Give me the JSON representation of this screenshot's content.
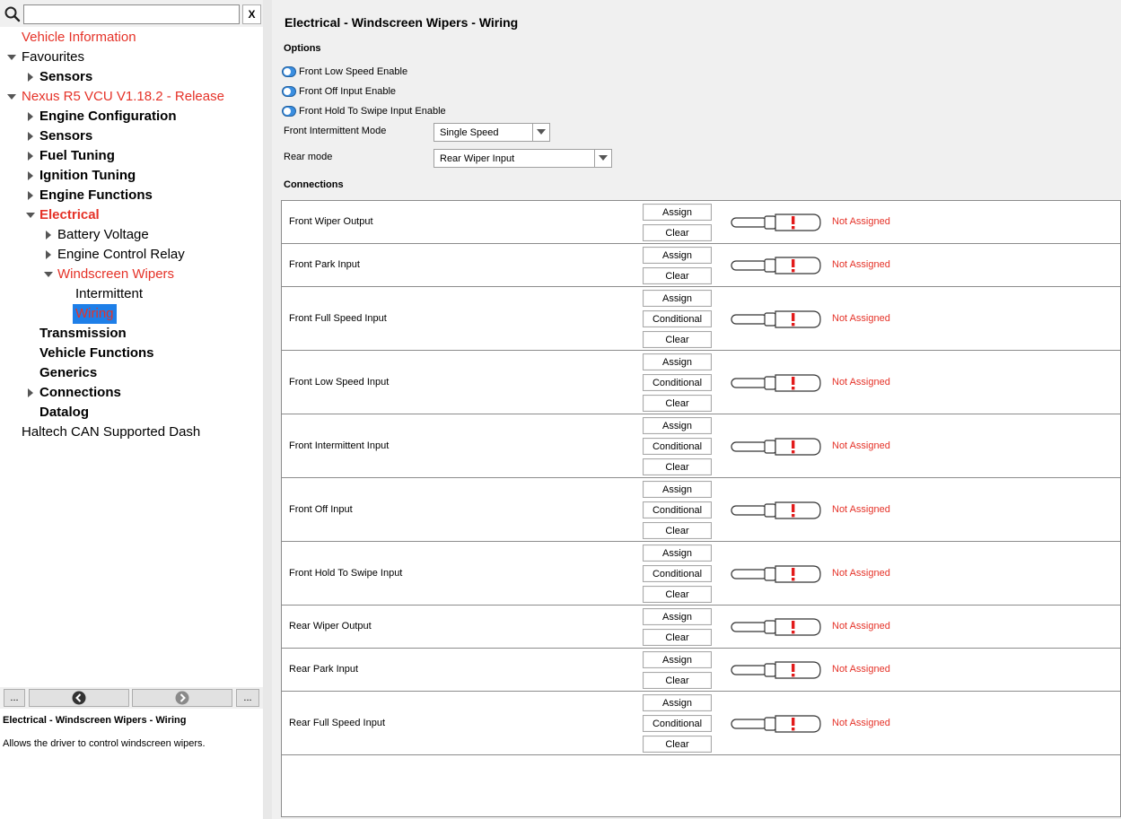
{
  "search": {
    "value": "",
    "clear_label": "X"
  },
  "tree": [
    {
      "label": "Vehicle Information",
      "level": 0,
      "arrow": "none",
      "style": "red"
    },
    {
      "label": "Favourites",
      "level": 0,
      "arrow": "down",
      "style": "normal"
    },
    {
      "label": "Sensors",
      "level": 1,
      "arrow": "right",
      "style": "bold"
    },
    {
      "label": "Nexus R5 VCU V1.18.2 - Release",
      "level": 0,
      "arrow": "down",
      "style": "red"
    },
    {
      "label": "Engine Configuration",
      "level": 1,
      "arrow": "right",
      "style": "bold"
    },
    {
      "label": "Sensors",
      "level": 1,
      "arrow": "right",
      "style": "bold"
    },
    {
      "label": "Fuel Tuning",
      "level": 1,
      "arrow": "right",
      "style": "bold"
    },
    {
      "label": "Ignition Tuning",
      "level": 1,
      "arrow": "right",
      "style": "bold"
    },
    {
      "label": "Engine Functions",
      "level": 1,
      "arrow": "right",
      "style": "bold"
    },
    {
      "label": "Electrical",
      "level": 1,
      "arrow": "down",
      "style": "red-bold"
    },
    {
      "label": "Battery Voltage",
      "level": 2,
      "arrow": "right",
      "style": "normal"
    },
    {
      "label": "Engine Control Relay",
      "level": 2,
      "arrow": "right",
      "style": "normal"
    },
    {
      "label": "Windscreen Wipers",
      "level": 2,
      "arrow": "down",
      "style": "red"
    },
    {
      "label": "Intermittent",
      "level": 3,
      "arrow": "none",
      "style": "normal"
    },
    {
      "label": "Wiring",
      "level": 3,
      "arrow": "none",
      "style": "selected"
    },
    {
      "label": "Transmission",
      "level": 1,
      "arrow": "none",
      "style": "bold"
    },
    {
      "label": "Vehicle Functions",
      "level": 1,
      "arrow": "none",
      "style": "bold"
    },
    {
      "label": "Generics",
      "level": 1,
      "arrow": "none",
      "style": "bold"
    },
    {
      "label": "Connections",
      "level": 1,
      "arrow": "right",
      "style": "bold"
    },
    {
      "label": "Datalog",
      "level": 1,
      "arrow": "none",
      "style": "bold"
    },
    {
      "label": "Haltech CAN Supported Dash",
      "level": 0,
      "arrow": "none",
      "style": "normal"
    }
  ],
  "nav": {
    "more_left": "...",
    "more_right": "..."
  },
  "description": {
    "title": "Electrical - Windscreen Wipers - Wiring",
    "text": "Allows the driver to control windscreen wipers."
  },
  "page": {
    "title": "Electrical - Windscreen Wipers - Wiring",
    "options_heading": "Options",
    "toggles": [
      {
        "label": "Front Low Speed Enable",
        "on": true
      },
      {
        "label": "Front Off Input Enable",
        "on": true
      },
      {
        "label": "Front Hold To Swipe Input Enable",
        "on": true
      }
    ],
    "front_mode": {
      "label": "Front Intermittent Mode",
      "value": "Single Speed"
    },
    "rear_mode": {
      "label": "Rear mode",
      "value": "Rear Wiper Input"
    },
    "connections_heading": "Connections"
  },
  "connections": [
    {
      "name": "Front Wiper Output",
      "buttons": [
        "Assign",
        "Clear"
      ],
      "status": "Not Assigned"
    },
    {
      "name": "Front Park Input",
      "buttons": [
        "Assign",
        "Clear"
      ],
      "status": "Not Assigned"
    },
    {
      "name": "Front Full Speed Input",
      "buttons": [
        "Assign",
        "Conditional",
        "Clear"
      ],
      "status": "Not Assigned"
    },
    {
      "name": "Front Low Speed Input",
      "buttons": [
        "Assign",
        "Conditional",
        "Clear"
      ],
      "status": "Not Assigned"
    },
    {
      "name": "Front Intermittent Input",
      "buttons": [
        "Assign",
        "Conditional",
        "Clear"
      ],
      "status": "Not Assigned"
    },
    {
      "name": "Front Off Input",
      "buttons": [
        "Assign",
        "Conditional",
        "Clear"
      ],
      "status": "Not Assigned"
    },
    {
      "name": "Front Hold To Swipe Input",
      "buttons": [
        "Assign",
        "Conditional",
        "Clear"
      ],
      "status": "Not Assigned"
    },
    {
      "name": "Rear Wiper Output",
      "buttons": [
        "Assign",
        "Clear"
      ],
      "status": "Not Assigned"
    },
    {
      "name": "Rear Park Input",
      "buttons": [
        "Assign",
        "Clear"
      ],
      "status": "Not Assigned"
    },
    {
      "name": "Rear Full Speed Input",
      "buttons": [
        "Assign",
        "Conditional",
        "Clear"
      ],
      "status": "Not Assigned"
    }
  ],
  "icons": {
    "search": "search-icon",
    "back": "back-arrow-icon",
    "forward": "forward-arrow-icon",
    "warning": "exclamation-icon",
    "connector": "connector-plug-icon"
  },
  "colors": {
    "accent": "#e53228",
    "selection": "#1e7fe8",
    "toggle": "#3a8ee0"
  }
}
